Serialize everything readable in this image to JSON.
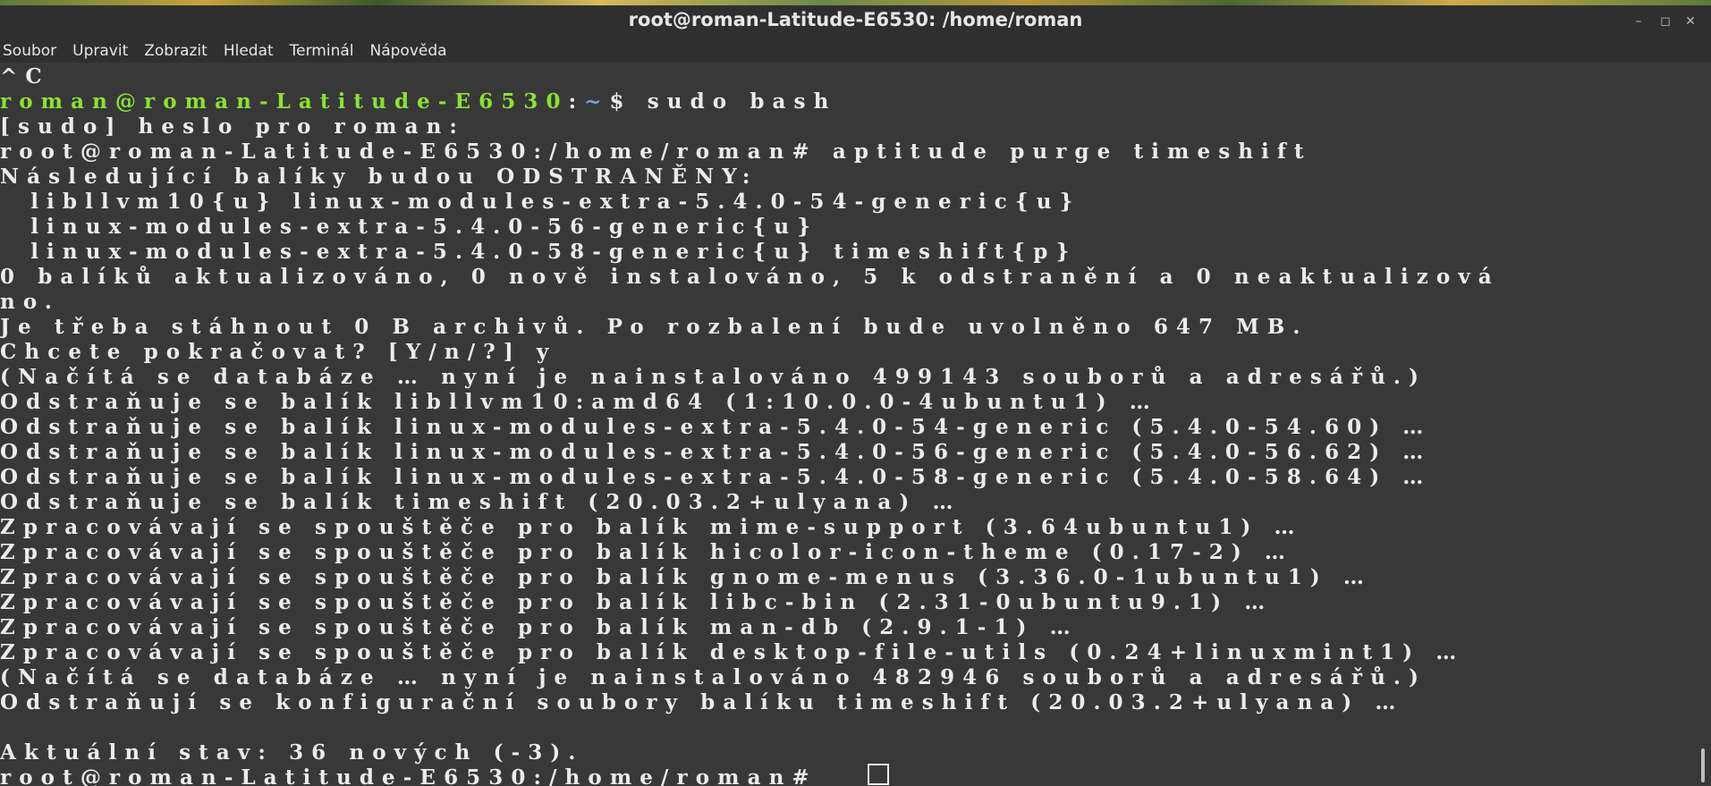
{
  "window": {
    "title": "root@roman-Latitude-E6530: /home/roman",
    "minimize_icon": "minimize-icon",
    "maximize_icon": "maximize-icon",
    "close_icon": "close-icon"
  },
  "menu": [
    "Soubor",
    "Upravit",
    "Zobrazit",
    "Hledat",
    "Terminál",
    "Nápověda"
  ],
  "terminal": {
    "prompt_user": {
      "userhost": "roman@roman-Latitude-E6530",
      "colon": ":",
      "path": "~",
      "command": "$ sudo bash"
    },
    "lines": [
      "^C",
      "",
      "[sudo] heslo pro roman:",
      "root@roman-Latitude-E6530:/home/roman# aptitude purge timeshift",
      "Následující balíky budou ODSTRANĚNY:",
      "  libllvm10{u} linux-modules-extra-5.4.0-54-generic{u}",
      "  linux-modules-extra-5.4.0-56-generic{u}",
      "  linux-modules-extra-5.4.0-58-generic{u} timeshift{p}",
      "0 balíků aktualizováno, 0 nově instalováno, 5 k odstranění a 0 neaktualizová",
      "no.",
      "Je třeba stáhnout 0 B archivů. Po rozbalení bude uvolněno 647 MB.",
      "Chcete pokračovat? [Y/n/?] y",
      "(Načítá se databáze … nyní je nainstalováno 499143 souborů a adresářů.)",
      "Odstraňuje se balík libllvm10:amd64 (1:10.0.0-4ubuntu1) …",
      "Odstraňuje se balík linux-modules-extra-5.4.0-54-generic (5.4.0-54.60) …",
      "Odstraňuje se balík linux-modules-extra-5.4.0-56-generic (5.4.0-56.62) …",
      "Odstraňuje se balík linux-modules-extra-5.4.0-58-generic (5.4.0-58.64) …",
      "Odstraňuje se balík timeshift (20.03.2+ulyana) …",
      "Zpracovávají se spouštěče pro balík mime-support (3.64ubuntu1) …",
      "Zpracovávají se spouštěče pro balík hicolor-icon-theme (0.17-2) …",
      "Zpracovávají se spouštěče pro balík gnome-menus (3.36.0-1ubuntu1) …",
      "Zpracovávají se spouštěče pro balík libc-bin (2.31-0ubuntu9.1) …",
      "Zpracovávají se spouštěče pro balík man-db (2.9.1-1) …",
      "Zpracovávají se spouštěče pro balík desktop-file-utils (0.24+linuxmint1) …",
      "(Načítá se databáze … nyní je nainstalováno 482946 souborů a adresářů.)",
      "Odstraňují se konfigurační soubory balíku timeshift (20.03.2+ulyana) …",
      "",
      "Aktuální stav: 36 nových (-3).",
      "root@roman-Latitude-E6530:/home/roman# "
    ]
  }
}
